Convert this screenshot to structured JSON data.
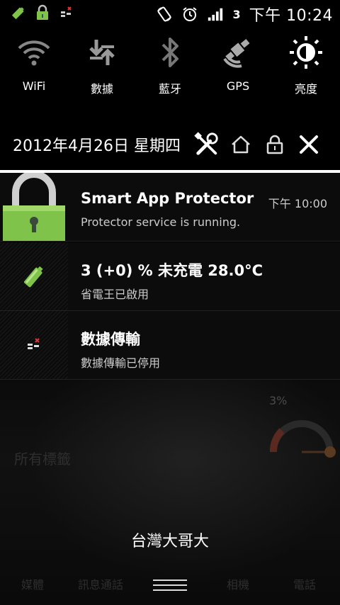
{
  "status_bar": {
    "network_label": "3",
    "time": "下午 10:24",
    "icons": [
      "battery-saver-icon",
      "lock-icon",
      "data-transfer-icon",
      "rotation-icon",
      "alarm-icon",
      "signal-icon"
    ]
  },
  "quick_settings": [
    {
      "label": "WiFi",
      "icon": "wifi-icon"
    },
    {
      "label": "數據",
      "icon": "data-icon"
    },
    {
      "label": "藍牙",
      "icon": "bluetooth-icon"
    },
    {
      "label": "GPS",
      "icon": "gps-icon"
    },
    {
      "label": "亮度",
      "icon": "brightness-icon"
    }
  ],
  "date_row": {
    "date": "2012年4月26日 星期四",
    "icons": [
      "settings-tools-icon",
      "home-icon",
      "lock-icon",
      "close-icon"
    ]
  },
  "notifications": [
    {
      "title": "Smart App Protector",
      "subtitle": "Protector service is running.",
      "time": "下午 10:00",
      "icon": "padlock-icon"
    },
    {
      "title": "3 (+0) %  未充電 28.0°C",
      "subtitle": "省電王已啟用",
      "time": "",
      "icon": "battery-icon"
    },
    {
      "title": "數據傳輸",
      "subtitle": "數據傳輸已停用",
      "time": "",
      "icon": "data-transfer-icon"
    }
  ],
  "background": {
    "tags_label": "所有標籤",
    "percent_label": "3%",
    "dock_labels": [
      "媒體",
      "訊息通話",
      "相機",
      "電話"
    ]
  },
  "carrier": "台灣大哥大",
  "colors": {
    "accent_green": "#7fc34a",
    "divider": "#ffffff"
  }
}
